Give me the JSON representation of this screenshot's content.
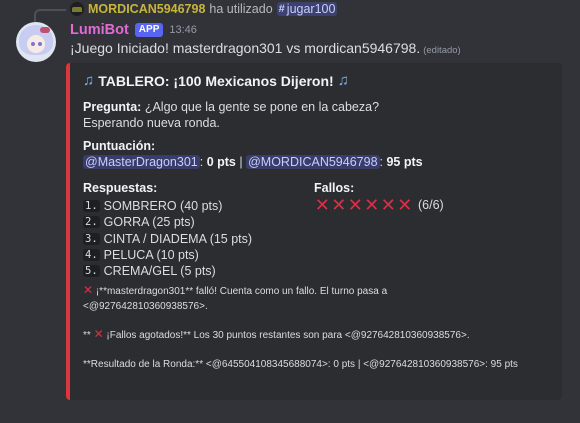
{
  "reply": {
    "username": "MORDICAN5946798",
    "verb": "ha utilizado",
    "command": "jugar100"
  },
  "message": {
    "author": "LumiBot",
    "badge": "APP",
    "time": "13:46",
    "text": "¡Juego Iniciado! masterdragon301 vs mordican5946798.",
    "edited": "(editado)"
  },
  "embed": {
    "accent_color": "#da373c",
    "title": "TABLERO: ¡100 Mexicanos Dijeron!",
    "question_label": "Pregunta:",
    "question": "¿Algo que la gente se pone en la cabeza?",
    "status": "Esperando nueva ronda.",
    "score_label": "Puntuación:",
    "player1": "@MasterDragon301",
    "player1_score": "0 pts",
    "separator": "|",
    "player2": "@MORDICAN5946798",
    "player2_score": "95 pts",
    "answers_label": "Respuestas:",
    "answers": [
      {
        "num": "1.",
        "text": "SOMBRERO (40 pts)"
      },
      {
        "num": "2.",
        "text": "GORRA (25 pts)"
      },
      {
        "num": "3.",
        "text": "CINTA / DIADEMA (15 pts)"
      },
      {
        "num": "4.",
        "text": "PELUCA (10 pts)"
      },
      {
        "num": "5.",
        "text": "CREMA/GEL (5 pts)"
      }
    ],
    "fails_label": "Fallos:",
    "fails_count": "(6/6)",
    "log1": " ¡**masterdragon301** falló! Cuenta como un fallo. El turno pasa a <@927642810360938576>.",
    "log2_prefix": "** ",
    "log2": " ¡Fallos agotados!** Los 30 puntos restantes son para <@927642810360938576>.",
    "log3": "**Resultado de la Ronda:** <@645504108345688074>: 0 pts | <@927642810360938576>: 95 pts"
  }
}
